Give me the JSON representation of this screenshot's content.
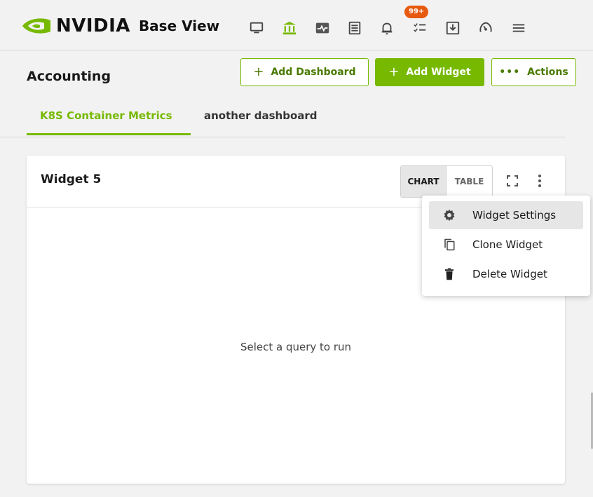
{
  "brand": {
    "logo_text": "NVIDIA",
    "product": "Base View",
    "accent": "#76b900"
  },
  "topnav": {
    "icons": [
      "monitor-icon",
      "bank-icon",
      "activity-icon",
      "document-icon",
      "bell-icon",
      "checklist-icon",
      "download-icon",
      "gauge-icon",
      "menu-icon"
    ],
    "notification_count": "99+",
    "badge_color": "#e7590e"
  },
  "header": {
    "title": "Accounting",
    "add_dashboard_label": "Add Dashboard",
    "add_widget_label": "Add Widget",
    "actions_label": "Actions"
  },
  "tabs": [
    {
      "label": "K8S Container Metrics",
      "active": true
    },
    {
      "label": "another dashboard",
      "active": false
    }
  ],
  "widget": {
    "title": "Widget 5",
    "view_chart_label": "CHART",
    "view_table_label": "TABLE",
    "selected_view": "CHART",
    "empty_message": "Select a query to run"
  },
  "widget_menu": {
    "items": [
      {
        "label": "Widget Settings",
        "icon": "gear-icon"
      },
      {
        "label": "Clone Widget",
        "icon": "copy-icon"
      },
      {
        "label": "Delete Widget",
        "icon": "trash-icon"
      }
    ]
  }
}
